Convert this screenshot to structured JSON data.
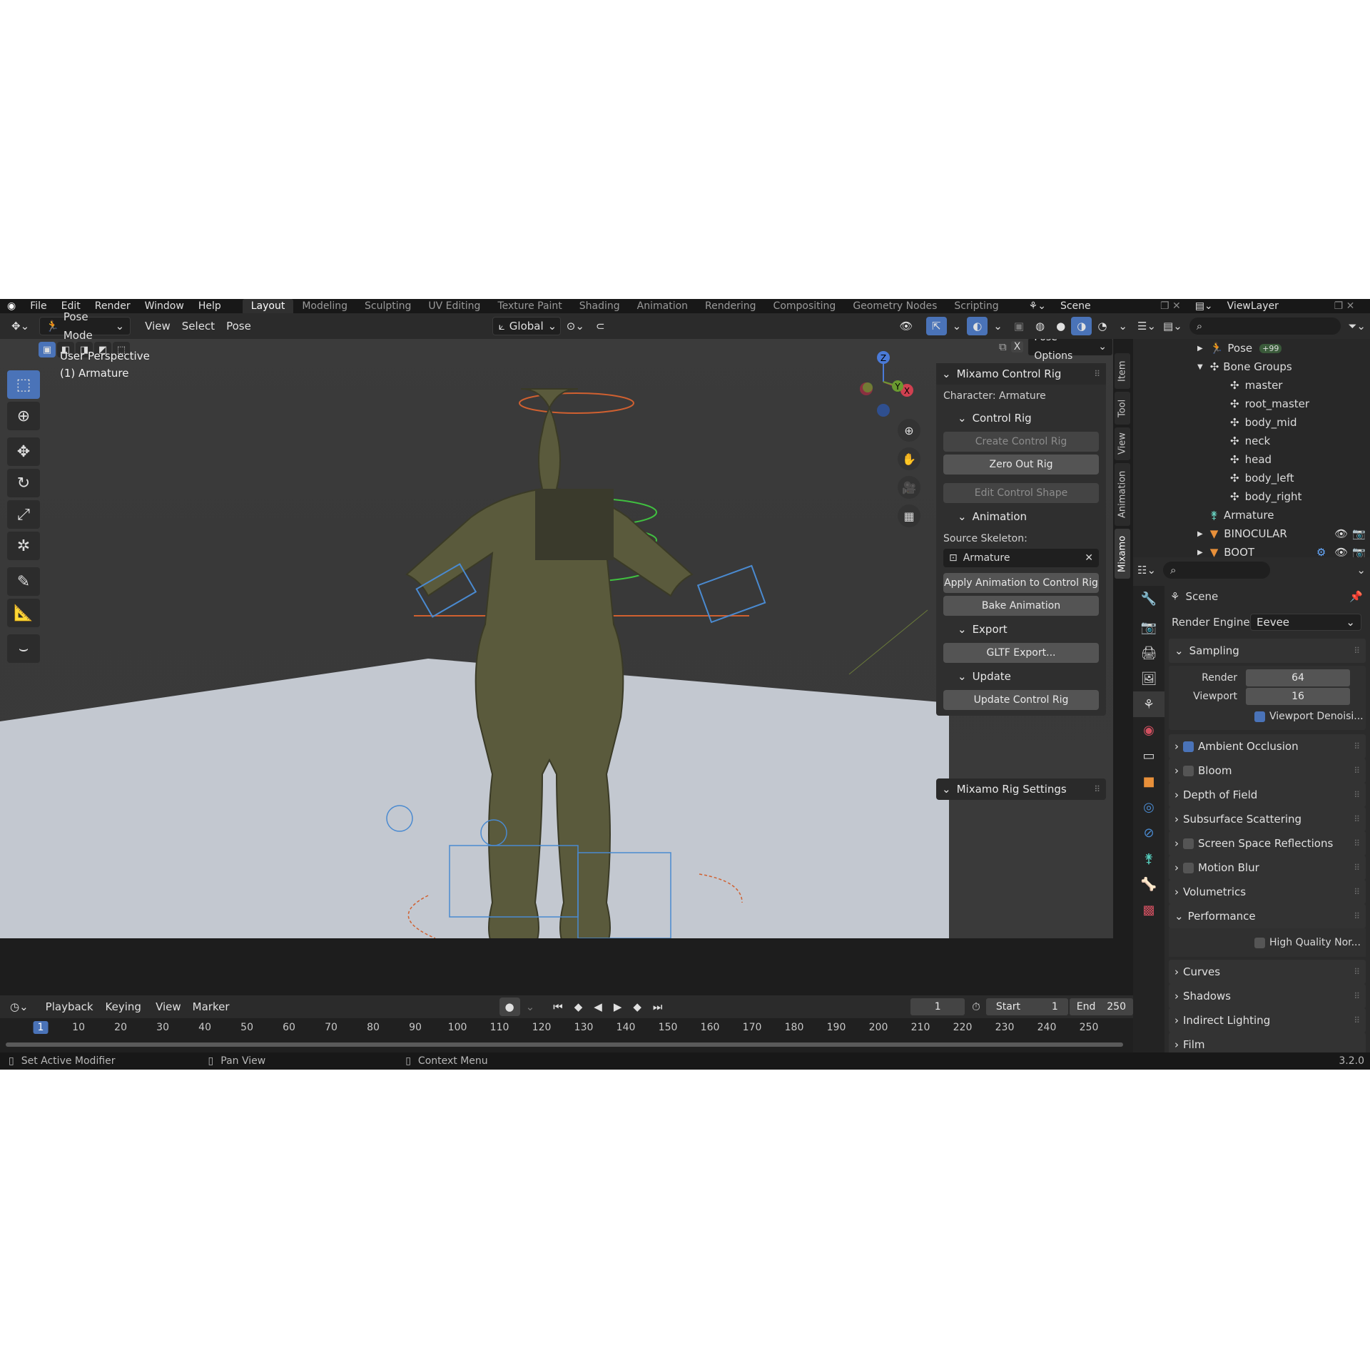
{
  "menu": [
    "File",
    "Edit",
    "Render",
    "Window",
    "Help"
  ],
  "workspaces": [
    "Layout",
    "Modeling",
    "Sculpting",
    "UV Editing",
    "Texture Paint",
    "Shading",
    "Animation",
    "Rendering",
    "Compositing",
    "Geometry Nodes",
    "Scripting"
  ],
  "scene_name": "Scene",
  "view_layer": "ViewLayer",
  "viewport_header": {
    "mode": "Pose Mode",
    "view": "View",
    "select": "Select",
    "pose": "Pose",
    "orientation": "Global",
    "pose_options": "Pose Options"
  },
  "viewport": {
    "perspective": "User Perspective",
    "active_object": "(1) Armature",
    "axis_x": "X",
    "axis_y": "Y",
    "axis_z": "Z"
  },
  "side_tabs": [
    "Item",
    "Tool",
    "View",
    "Animation",
    "Mixamo"
  ],
  "mixamo": {
    "title": "Mixamo Control Rig",
    "character": "Character: Armature",
    "control_rig": "Control Rig",
    "create_control_rig": "Create Control Rig",
    "zero_out_rig": "Zero Out Rig",
    "edit_control_shape": "Edit Control Shape",
    "animation": "Animation",
    "source_skeleton_label": "Source Skeleton:",
    "source_skeleton_value": "Armature",
    "apply_animation": "Apply Animation to Control Rig",
    "bake_animation": "Bake Animation",
    "export": "Export",
    "gltf_export": "GLTF Export...",
    "update": "Update",
    "update_control_rig": "Update Control Rig",
    "settings": "Mixamo Rig Settings"
  },
  "outliner": {
    "pose": "Pose",
    "pose_badge": "+99",
    "bone_groups": "Bone Groups",
    "groups": [
      "master",
      "root_master",
      "body_mid",
      "neck",
      "head",
      "body_left",
      "body_right"
    ],
    "armature": "Armature",
    "binocular": "BINOCULAR",
    "boot": "BOOT"
  },
  "properties": {
    "scene_title": "Scene",
    "render_engine_label": "Render Engine",
    "render_engine_value": "Eevee",
    "sampling": "Sampling",
    "render_label": "Render",
    "render_value": "64",
    "viewport_label": "Viewport",
    "viewport_value": "16",
    "viewport_denoising": "Viewport Denoisi...",
    "sections": [
      {
        "label": "Ambient Occlusion",
        "checkbox": true,
        "checked": true
      },
      {
        "label": "Bloom",
        "checkbox": true,
        "checked": false
      },
      {
        "label": "Depth of Field",
        "checkbox": false,
        "checked": false
      },
      {
        "label": "Subsurface Scattering",
        "checkbox": false,
        "checked": false
      },
      {
        "label": "Screen Space Reflections",
        "checkbox": true,
        "checked": false
      },
      {
        "label": "Motion Blur",
        "checkbox": true,
        "checked": false
      },
      {
        "label": "Volumetrics",
        "checkbox": false,
        "checked": false
      }
    ],
    "performance": "Performance",
    "high_quality_normals": "High Quality Nor...",
    "more_sections": [
      "Curves",
      "Shadows",
      "Indirect Lighting",
      "Film"
    ]
  },
  "timeline": {
    "playback": "Playback",
    "keying": "Keying",
    "view": "View",
    "marker": "Marker",
    "current_frame": "1",
    "start_label": "Start",
    "start_value": "1",
    "end_label": "End",
    "end_value": "250",
    "ruler": [
      "1",
      "10",
      "20",
      "30",
      "40",
      "50",
      "60",
      "70",
      "80",
      "90",
      "100",
      "110",
      "120",
      "130",
      "140",
      "150",
      "160",
      "170",
      "180",
      "190",
      "200",
      "210",
      "220",
      "230",
      "240",
      "250"
    ]
  },
  "status": {
    "left": "Set Active Modifier",
    "middle": "Pan View",
    "right": "Context Menu",
    "version": "3.2.0"
  },
  "colors": {
    "accent": "#4a73b8",
    "bg": "#1d1d1d",
    "panel": "#2b2b2b"
  }
}
